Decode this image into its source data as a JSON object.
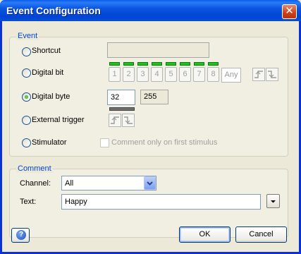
{
  "window": {
    "title": "Event Configuration",
    "close_glyph": "✕"
  },
  "event_group": {
    "title": "Event",
    "shortcut": {
      "label": "Shortcut",
      "value": ""
    },
    "digital_bit": {
      "label": "Digital bit",
      "bits": [
        "1",
        "2",
        "3",
        "4",
        "5",
        "6",
        "7",
        "8"
      ],
      "any_label": "Any"
    },
    "digital_byte": {
      "label": "Digital byte",
      "value": "32",
      "readonly_value": "255"
    },
    "external_trigger": {
      "label": "External trigger"
    },
    "stimulator": {
      "label": "Stimulator",
      "checkbox_label": "Comment only on first stimulus"
    }
  },
  "comment_group": {
    "title": "Comment",
    "channel_label": "Channel:",
    "channel_value": "All",
    "text_label": "Text:",
    "text_value": "Happy"
  },
  "footer": {
    "help_glyph": "?",
    "ok_label": "OK",
    "cancel_label": "Cancel"
  },
  "colors": {
    "titlebar": "#0a55e0",
    "group_title": "#0046d5",
    "led_on": "#21c021"
  },
  "icons": [
    "close-icon",
    "help-icon",
    "rising-edge-icon",
    "falling-edge-icon",
    "chevron-down-icon"
  ]
}
